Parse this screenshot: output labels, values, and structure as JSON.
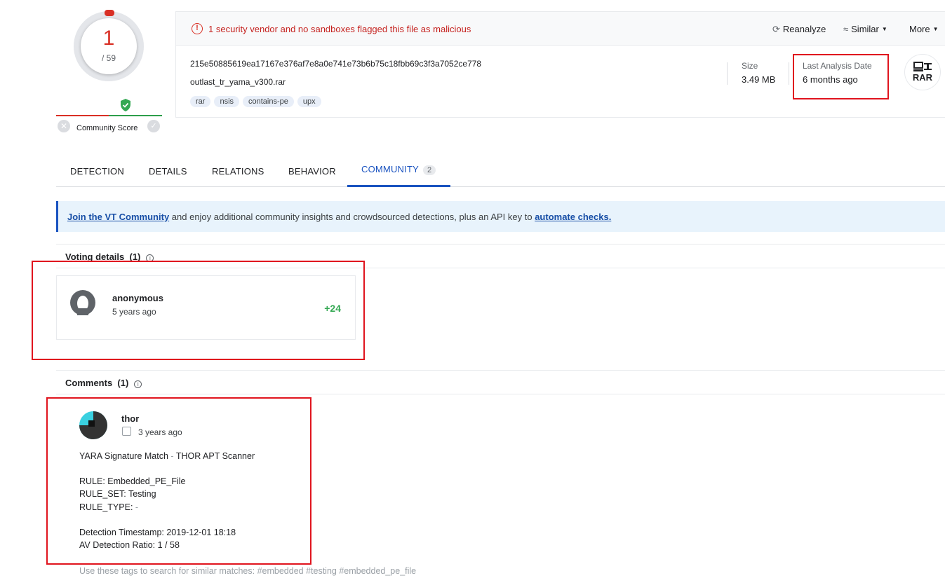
{
  "score": {
    "detections": "1",
    "total": "/ 59"
  },
  "community_score": {
    "label": "Community Score"
  },
  "header": {
    "alert": "1 security vendor and no sandboxes flagged this file as malicious",
    "actions": {
      "reanalyze": "Reanalyze",
      "similar": "Similar",
      "more": "More"
    },
    "sha256": "215e50885619ea17167e376af7e8a0e741e73b6b75c18fbb69c3f3a7052ce778",
    "filename": "outlast_tr_yama_v300.rar",
    "tags": [
      "rar",
      "nsis",
      "contains-pe",
      "upx"
    ],
    "size_label": "Size",
    "size_value": "3.49 MB",
    "date_label": "Last Analysis Date",
    "date_value": "6 months ago",
    "file_type": "RAR"
  },
  "tabs": {
    "detection": "DETECTION",
    "details": "DETAILS",
    "relations": "RELATIONS",
    "behavior": "BEHAVIOR",
    "community": "COMMUNITY",
    "community_count": "2"
  },
  "banner": {
    "join_link": "Join the VT Community",
    "middle": " and enjoy additional community insights and crowdsourced detections, plus an API key to ",
    "automate_link": "automate checks."
  },
  "voting": {
    "title": "Voting details",
    "count": "(1)",
    "user": "anonymous",
    "time": "5 years ago",
    "score": "+24"
  },
  "comments": {
    "title": "Comments",
    "count": "(1)",
    "user": "thor",
    "time": "3 years ago",
    "lines": {
      "l1a": "YARA Signature Match",
      "l1b": " - ",
      "l1c": "THOR APT Scanner",
      "rule": "RULE: Embedded_PE_File",
      "rule_set": "RULE_SET: Testing",
      "rule_type_a": "RULE_TYPE:",
      "rule_type_b": " -",
      "timestamp": "Detection Timestamp: 2019-12-01 18:18",
      "ratio": "AV Detection Ratio: 1 / 58",
      "tags": "Use these tags to search for similar matches: #embedded #testing #embedded_pe_file"
    }
  },
  "colors": {
    "malicious": "#d93025",
    "accent": "#1a53c0",
    "positive": "#34a853",
    "highlight_box": "#e0141e"
  }
}
